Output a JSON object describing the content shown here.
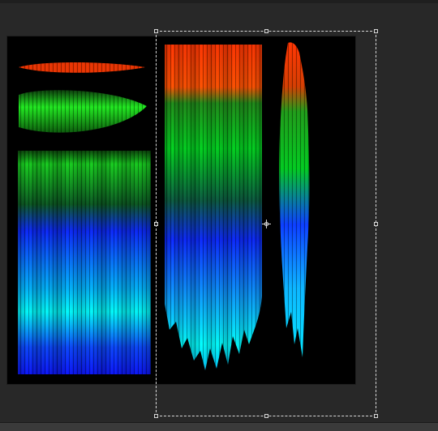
{
  "editor": {
    "canvas_background": "#000000",
    "workspace_background": "#282828",
    "gradient_colors": {
      "red": "#ff3300",
      "green": "#00d21e",
      "blue": "#0a28ff",
      "cyan": "#00ffff"
    }
  },
  "transform": {
    "mode": "free-transform",
    "handle_icons": [
      "corner-handle-icon",
      "edge-handle-icon"
    ],
    "pivot_icon": "crosshair-icon"
  }
}
